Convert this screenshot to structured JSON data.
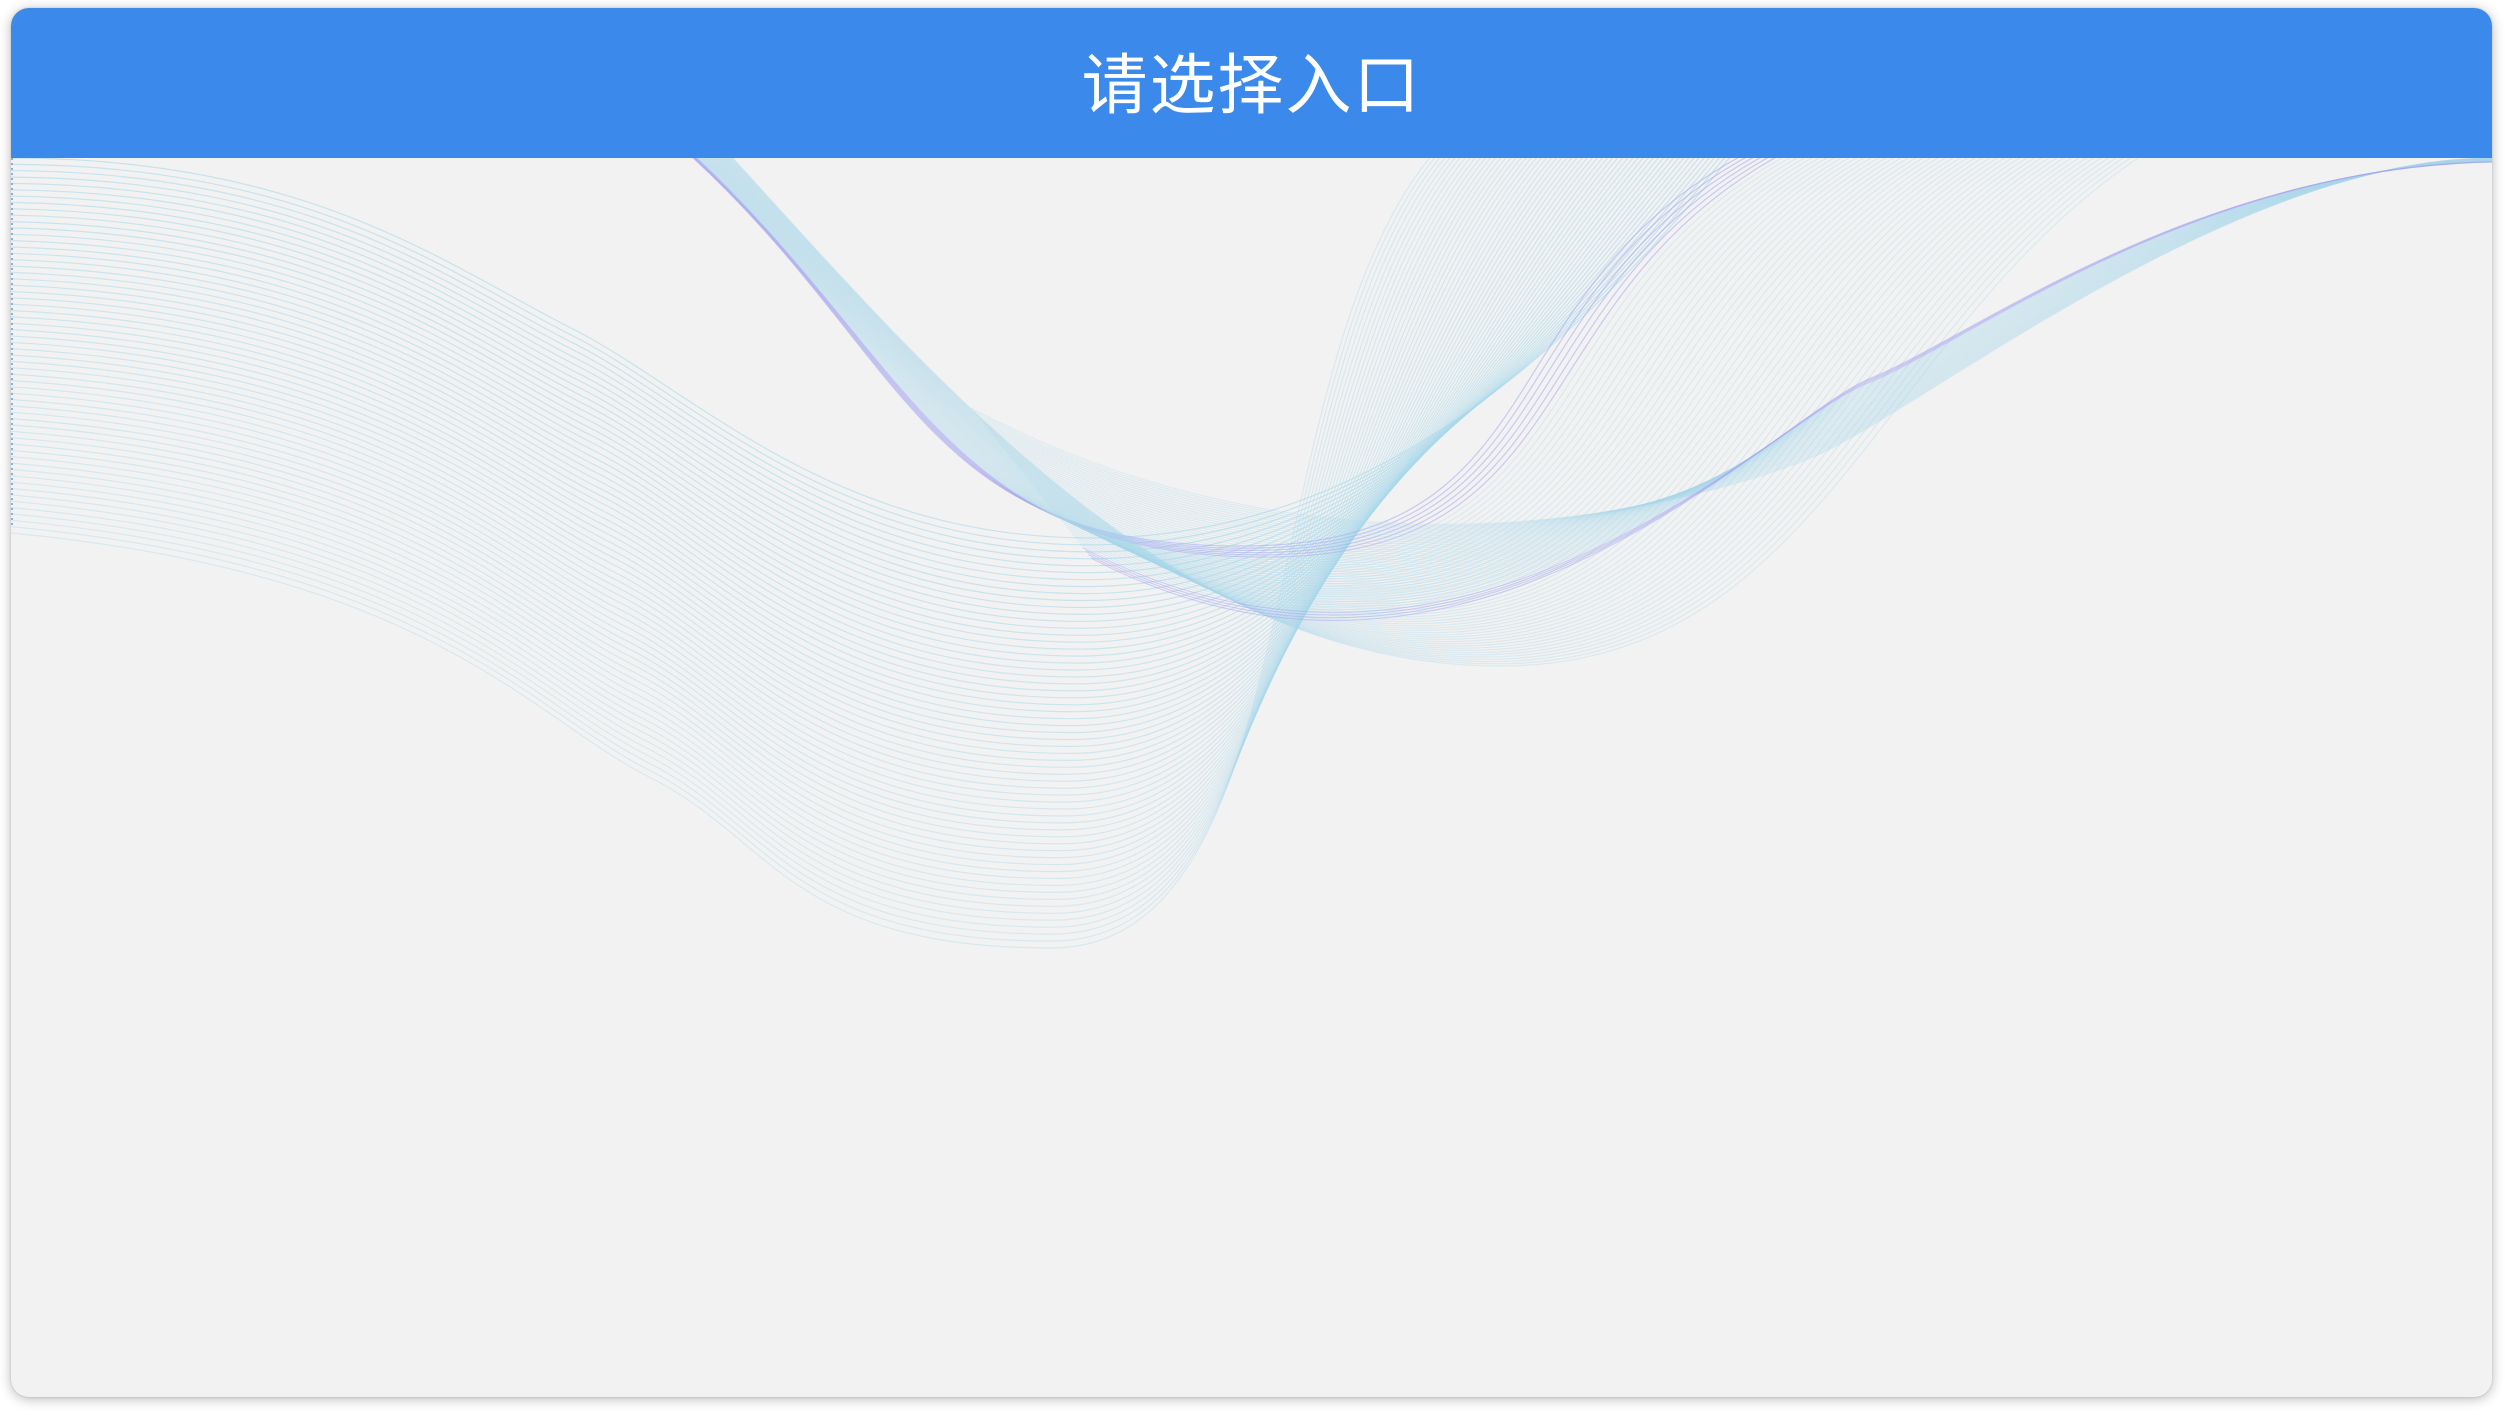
{
  "dialog": {
    "title": "请选择入口"
  },
  "colors": {
    "header": "#3b8aeb",
    "title_text": "#ffffff",
    "body_background": "#f2f2f2",
    "wave_light": "#a9d8ea",
    "wave_accent": "#a8a6f0"
  },
  "decoration": {
    "background_pattern": "flowing-line-waves"
  }
}
